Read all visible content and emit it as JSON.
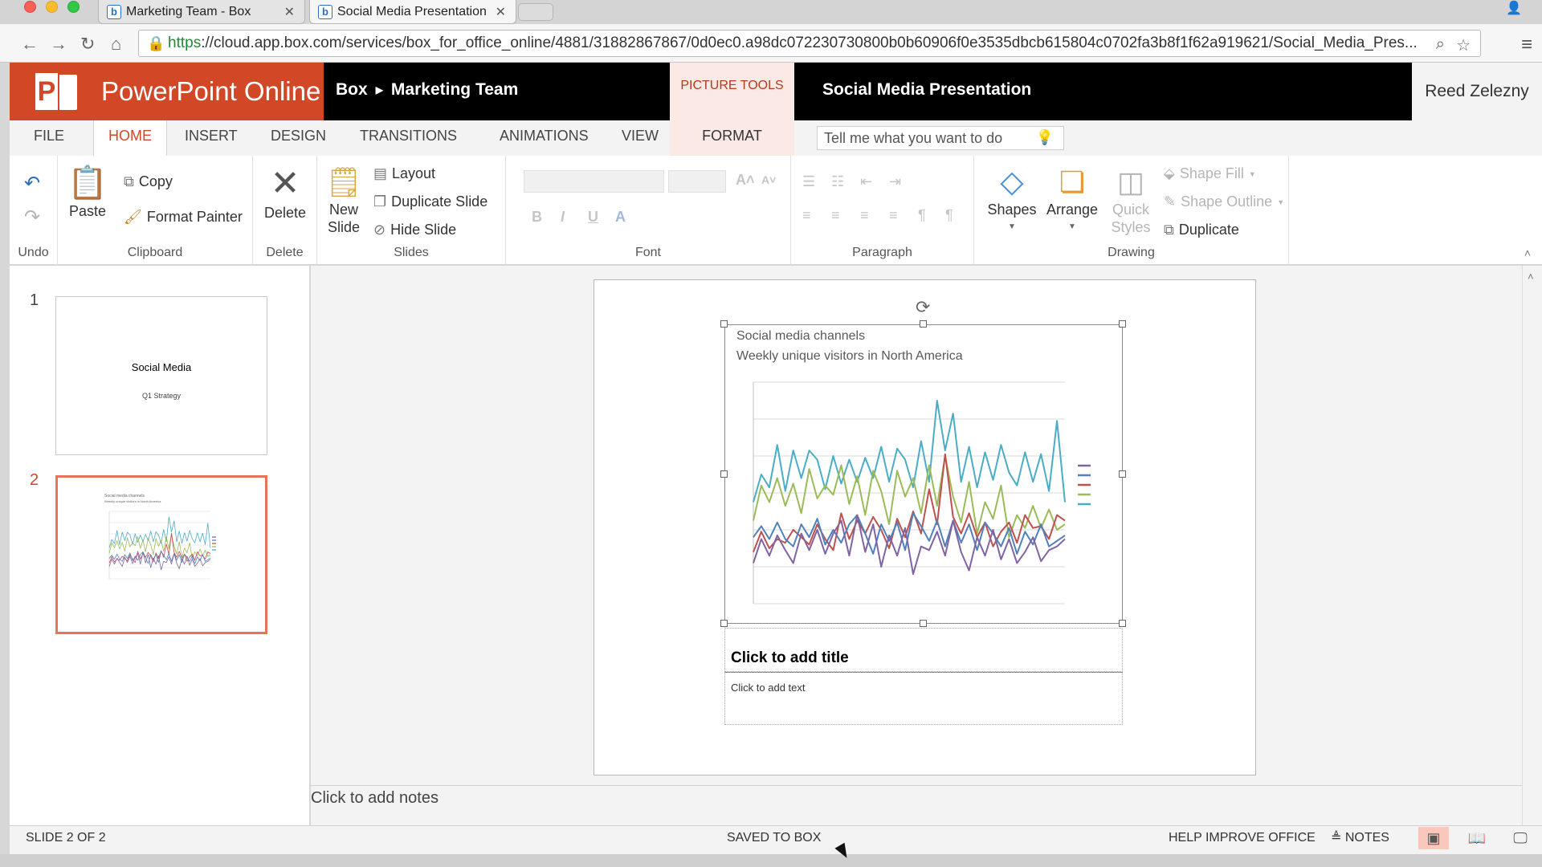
{
  "browser": {
    "tabs": [
      {
        "label": "Marketing Team - Box",
        "favicon": "b"
      },
      {
        "label": "Social Media Presentation",
        "favicon": "b"
      }
    ],
    "url_scheme": "https",
    "url_rest": "://cloud.app.box.com/services/box_for_office_online/4881/31882867867/0d0ec0.a98dc072230730800b0b60906f0e3535dbcb615804c0702fa3b8f1f62a919621/Social_Media_Pres..."
  },
  "app": {
    "brand": "PowerPoint Online",
    "breadcrumb": {
      "root": "Box",
      "folder": "Marketing Team"
    },
    "contextual_tab": "PICTURE TOOLS",
    "document_title": "Social Media Presentation",
    "user": "Reed Zelezny"
  },
  "ribbon_tabs": {
    "file": "FILE",
    "home": "HOME",
    "insert": "INSERT",
    "design": "DESIGN",
    "transitions": "TRANSITIONS",
    "animations": "ANIMATIONS",
    "view": "VIEW",
    "format": "FORMAT",
    "tell_me_placeholder": "Tell me what you want to do"
  },
  "ribbon": {
    "undo_group": "Undo",
    "clipboard": {
      "paste": "Paste",
      "copy": "Copy",
      "format_painter": "Format Painter",
      "label": "Clipboard"
    },
    "delete": {
      "button": "Delete",
      "label": "Delete"
    },
    "slides": {
      "new_slide_1": "New",
      "new_slide_2": "Slide",
      "layout": "Layout",
      "duplicate": "Duplicate Slide",
      "hide": "Hide Slide",
      "label": "Slides"
    },
    "font": {
      "label": "Font"
    },
    "paragraph": {
      "label": "Paragraph"
    },
    "drawing": {
      "shapes": "Shapes",
      "arrange": "Arrange",
      "quick_1": "Quick",
      "quick_2": "Styles",
      "shape_fill": "Shape Fill",
      "shape_outline": "Shape Outline",
      "duplicate": "Duplicate",
      "label": "Drawing"
    }
  },
  "thumbnails": [
    {
      "number": "1",
      "title": "Social Media",
      "subtitle": "Q1 Strategy"
    },
    {
      "number": "2",
      "title": "Social media channels",
      "subtitle": "Weekly unique visitors in North America"
    }
  ],
  "slide": {
    "title_placeholder": "Click to add title",
    "text_placeholder": "Click to add text"
  },
  "notes_placeholder": "Click to add notes",
  "status": {
    "slide_counter": "SLIDE 2 OF 2",
    "save_state": "SAVED TO BOX",
    "help": "HELP IMPROVE OFFICE",
    "notes": "NOTES"
  },
  "chart_data": {
    "type": "line",
    "title": "Social media channels",
    "subtitle": "Weekly unique visitors in North America",
    "xlabel": "",
    "ylabel": "",
    "grid": true,
    "legend": "right",
    "x_count": 40,
    "ylim": [
      0,
      12
    ],
    "series": [
      {
        "color": "#4bacc6",
        "values": [
          5.5,
          7,
          6.3,
          8.6,
          6.1,
          8.3,
          6.8,
          8.3,
          7.8,
          6.2,
          8,
          6.5,
          7.8,
          6.6,
          7.9,
          6.8,
          8.5,
          6.6,
          8.4,
          7.8,
          6.3,
          8.8,
          6.6,
          11,
          8.3,
          10.3,
          6.6,
          8.5,
          6.3,
          8.2,
          6.7,
          8.6,
          7.1,
          6.4,
          8.2,
          6.6,
          8.1,
          6.1,
          9.9,
          5.5
        ]
      },
      {
        "color": "#9bbb59",
        "values": [
          4.5,
          6.4,
          5.5,
          6.8,
          5.3,
          6.5,
          4.9,
          7.3,
          5.7,
          6.4,
          5.9,
          7.5,
          5.4,
          6.9,
          4.8,
          7.2,
          6.1,
          4.3,
          7.2,
          5.8,
          6.8,
          4.9,
          7.5,
          5.3,
          8,
          5.8,
          4.4,
          6.6,
          3.8,
          5.5,
          4.6,
          6.4,
          3.6,
          4.8,
          4.1,
          5.3,
          4.1,
          5.1,
          4,
          4.3
        ]
      },
      {
        "color": "#c0504d",
        "values": [
          2.8,
          3.9,
          3,
          3.5,
          3.3,
          4,
          3.6,
          3.2,
          4.3,
          3.5,
          2.9,
          4.9,
          3.5,
          4.5,
          3.8,
          4.7,
          4,
          3,
          4.6,
          3.6,
          5,
          3.8,
          6.2,
          4.3,
          8.1,
          4.7,
          3.8,
          4.9,
          3.6,
          4.4,
          3.1,
          3.9,
          4.4,
          3.3,
          4.8,
          4.1,
          4.2,
          3.5,
          4.8,
          4.5
        ]
      },
      {
        "color": "#4f81bd",
        "values": [
          3.6,
          4.2,
          3.5,
          4.4,
          3.5,
          3.1,
          4.3,
          3.6,
          4.6,
          3.2,
          4,
          3.3,
          4.3,
          4.8,
          3.8,
          2.7,
          4.3,
          3.4,
          4.4,
          2.9,
          4.9,
          4.2,
          3.4,
          4.5,
          3.1,
          4.5,
          3.3,
          4.3,
          2.9,
          4.4,
          3.8,
          3.1,
          4.1,
          2.7,
          3.9,
          3.2,
          4.3,
          3.1,
          3.4,
          3.7
        ]
      },
      {
        "color": "#8064a2",
        "values": [
          2.2,
          3.5,
          2.6,
          3.7,
          2.9,
          2.2,
          3.8,
          2.9,
          4,
          2.7,
          3.8,
          4.5,
          2.6,
          4.8,
          2.8,
          4.3,
          2,
          3.7,
          2.6,
          4.1,
          1.6,
          3.1,
          2.9,
          3.9,
          2.6,
          4.5,
          2.8,
          1.8,
          3.6,
          2.6,
          4,
          2.4,
          3.5,
          2.2,
          2.8,
          3.6,
          2.3,
          2.9,
          3.1,
          3.5
        ]
      }
    ]
  }
}
